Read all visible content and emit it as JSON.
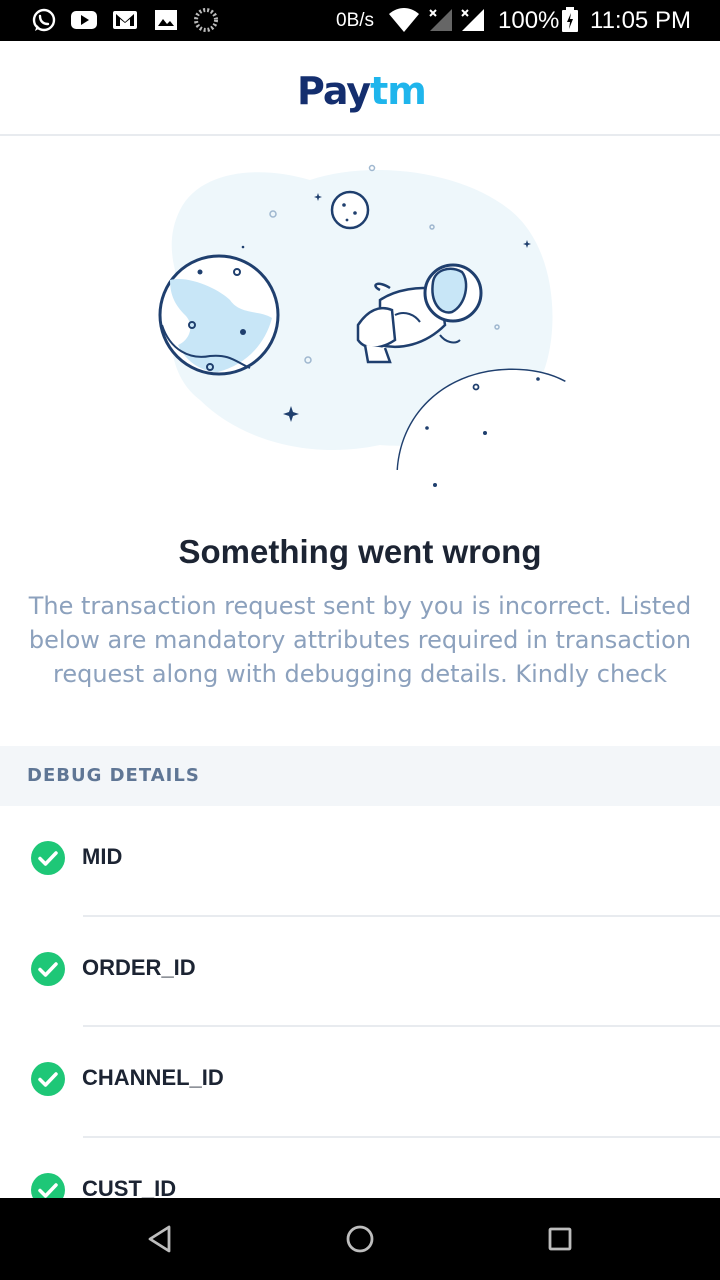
{
  "status_bar": {
    "net_speed": "0B/s",
    "battery_percent": "100%",
    "time": "11:05 PM",
    "notification_icons": [
      "whatsapp-icon",
      "youtube-icon",
      "gmail-icon",
      "gallery-icon",
      "sync-icon"
    ],
    "system_icons": [
      "wifi-icon",
      "signal-icon",
      "signal-icon",
      "battery-icon"
    ]
  },
  "header": {
    "logo_pay": "Pay",
    "logo_tm": "tm"
  },
  "error": {
    "title": "Something went wrong",
    "message": "The transaction request sent by you is incorrect. Listed below are mandatory attributes required in transaction request along with debugging details. Kindly check"
  },
  "debug": {
    "title": "DEBUG DETAILS",
    "items": [
      {
        "label": "MID",
        "status": "ok"
      },
      {
        "label": "ORDER_ID",
        "status": "ok"
      },
      {
        "label": "CHANNEL_ID",
        "status": "ok"
      },
      {
        "label": "CUST_ID",
        "status": "ok"
      }
    ]
  },
  "nav": {
    "icons": [
      "back-icon",
      "home-icon",
      "recents-icon"
    ]
  },
  "colors": {
    "brand_navy": "#142e6e",
    "brand_blue": "#1fb5ec",
    "success_green": "#1ec777",
    "muted_text": "#8ca1bd"
  }
}
